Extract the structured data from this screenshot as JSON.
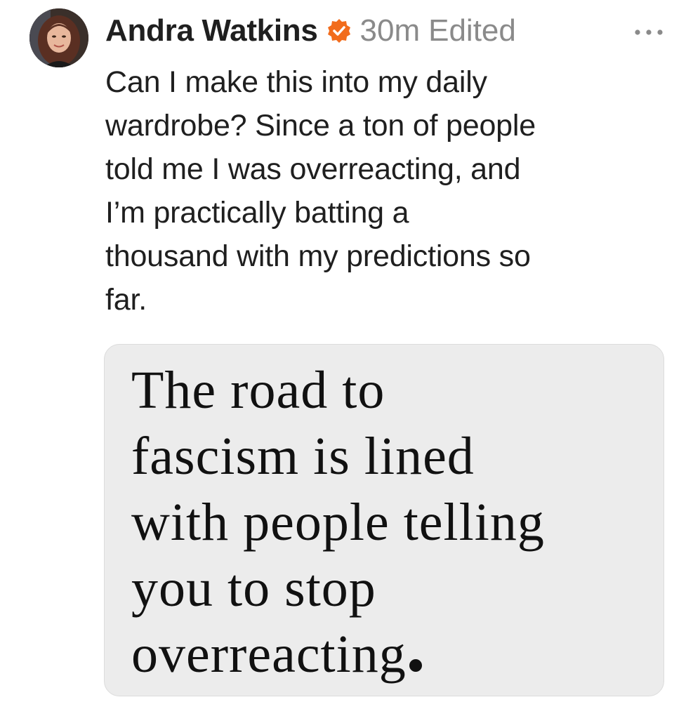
{
  "post": {
    "author": "Andra Watkins",
    "verified_icon": "verified-badge-icon",
    "verified_color": "#f26c1c",
    "timestamp": "30m",
    "edited": "Edited",
    "more_icon": "more-options-icon",
    "text_lines": [
      "Can I make this into my daily",
      "wardrobe? Since a ton of people",
      "told me I was overreacting, and",
      "I’m practically batting a",
      "thousand with my predictions so",
      "far."
    ],
    "attachment": {
      "quote_lines": [
        "The road to",
        "fascism is lined",
        "with people telling",
        "you to stop",
        "overreacting"
      ],
      "background": "#ececec"
    }
  }
}
